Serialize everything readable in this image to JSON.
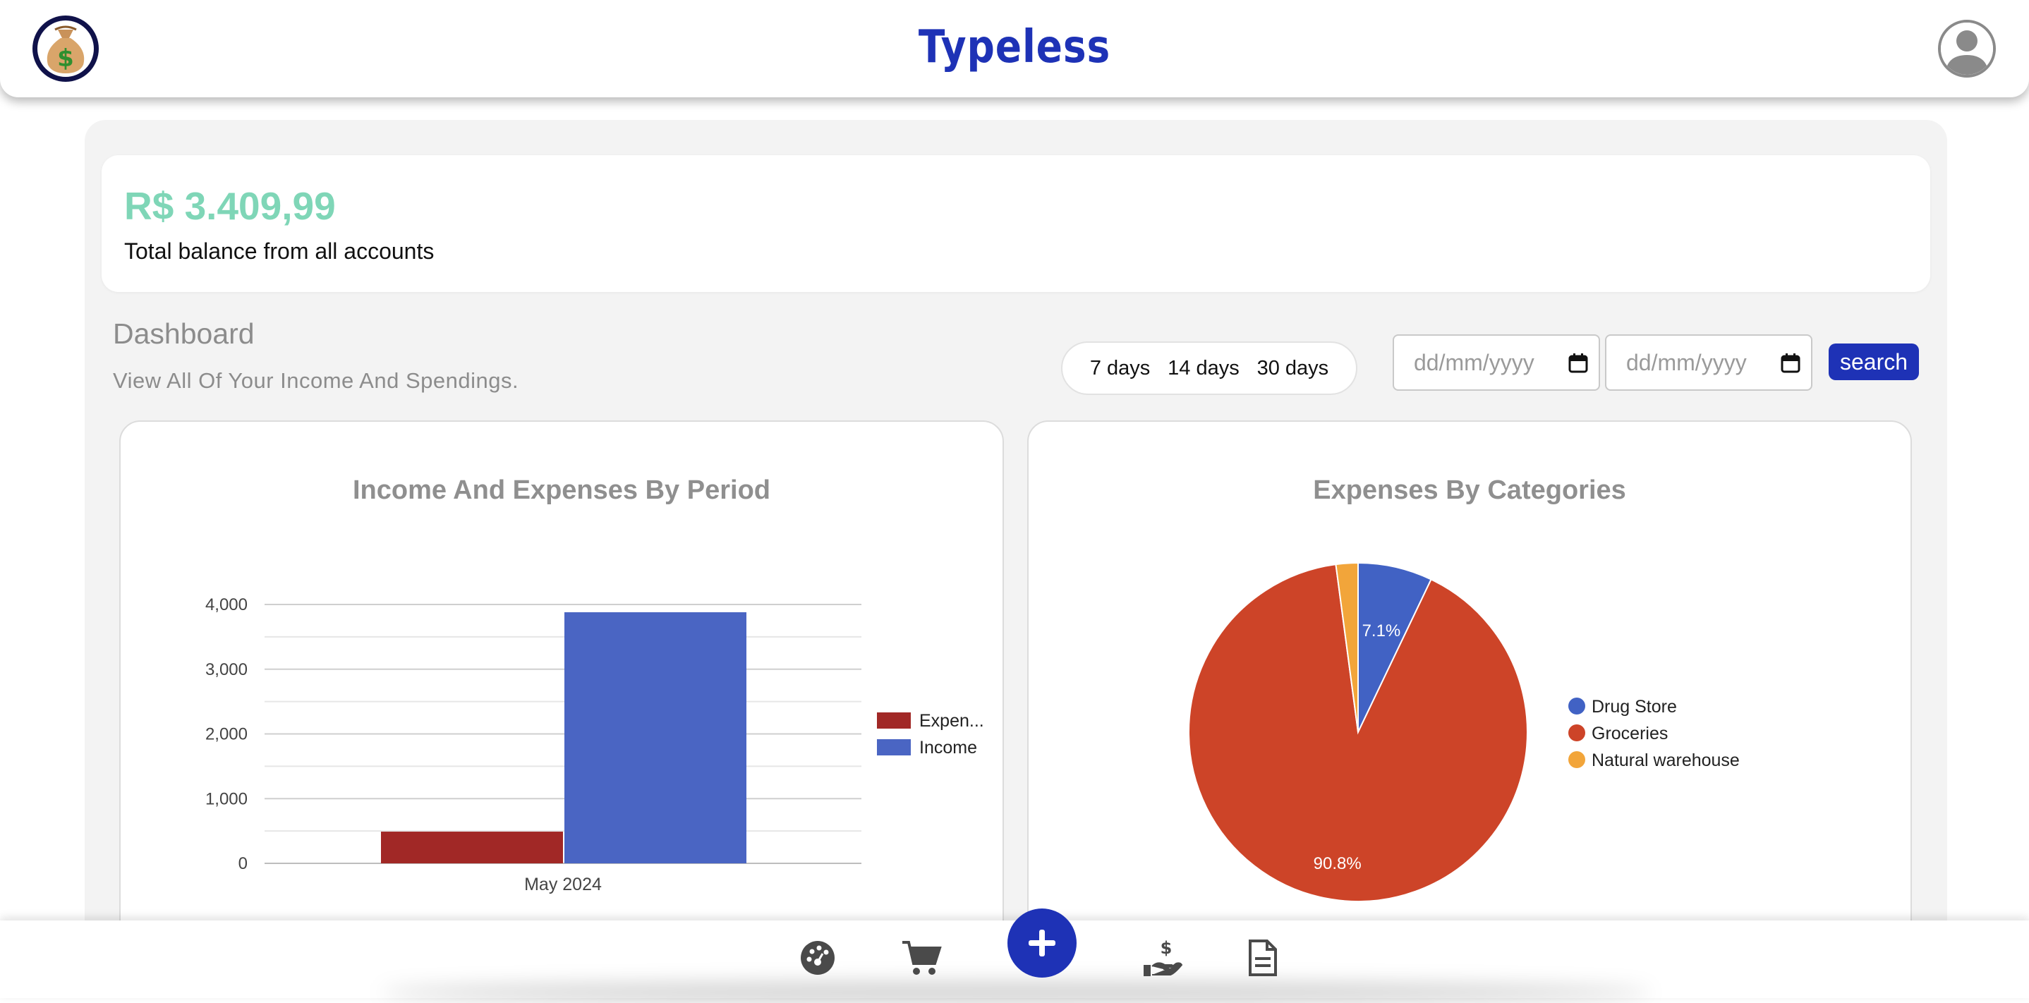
{
  "header": {
    "title": "Typeless",
    "logo_icon": "money-bag-icon",
    "avatar_icon": "user-avatar-icon"
  },
  "balance": {
    "amount": "R$ 3.409,99",
    "caption": "Total balance from all accounts"
  },
  "dashboard": {
    "title": "Dashboard",
    "subtitle": "View All Of Your Income And Spendings.",
    "periods": [
      "7 days",
      "14 days",
      "30 days"
    ],
    "date_from_placeholder": "dd/mm/yyyy",
    "date_to_placeholder": "dd/mm/yyyy",
    "search_label": "search"
  },
  "charts": {
    "bar_title": "Income And Expenses By Period",
    "pie_title": "Expenses By Categories"
  },
  "chart_data": [
    {
      "type": "bar",
      "title": "Income And Expenses By Period",
      "categories": [
        "May 2024"
      ],
      "series": [
        {
          "name": "Expenses",
          "legend_label": "Expen...",
          "values": [
            490
          ],
          "color": "#a12826"
        },
        {
          "name": "Income",
          "legend_label": "Income",
          "values": [
            3880
          ],
          "color": "#4a65c3"
        }
      ],
      "ylim": [
        0,
        4000
      ],
      "yticks": [
        0,
        1000,
        2000,
        3000,
        4000
      ],
      "ytick_labels": [
        "0",
        "1,000",
        "2,000",
        "3,000",
        "4,000"
      ],
      "grid": true,
      "legend": "right"
    },
    {
      "type": "pie",
      "title": "Expenses By Categories",
      "slices": [
        {
          "label": "Drug Store",
          "value": 7.1,
          "display": "7.1%",
          "color": "#4162c4"
        },
        {
          "label": "Groceries",
          "value": 90.8,
          "display": "90.8%",
          "color": "#cd4428"
        },
        {
          "label": "Natural warehouse",
          "value": 2.1,
          "display": "",
          "color": "#f2a53a"
        }
      ],
      "legend": "right"
    }
  ],
  "nav": {
    "items": [
      "dashboard-icon",
      "cart-icon",
      "add-icon",
      "hand-money-icon",
      "document-icon"
    ]
  },
  "colors": {
    "brand": "#1e32b6",
    "balance": "#7fd6b7"
  }
}
